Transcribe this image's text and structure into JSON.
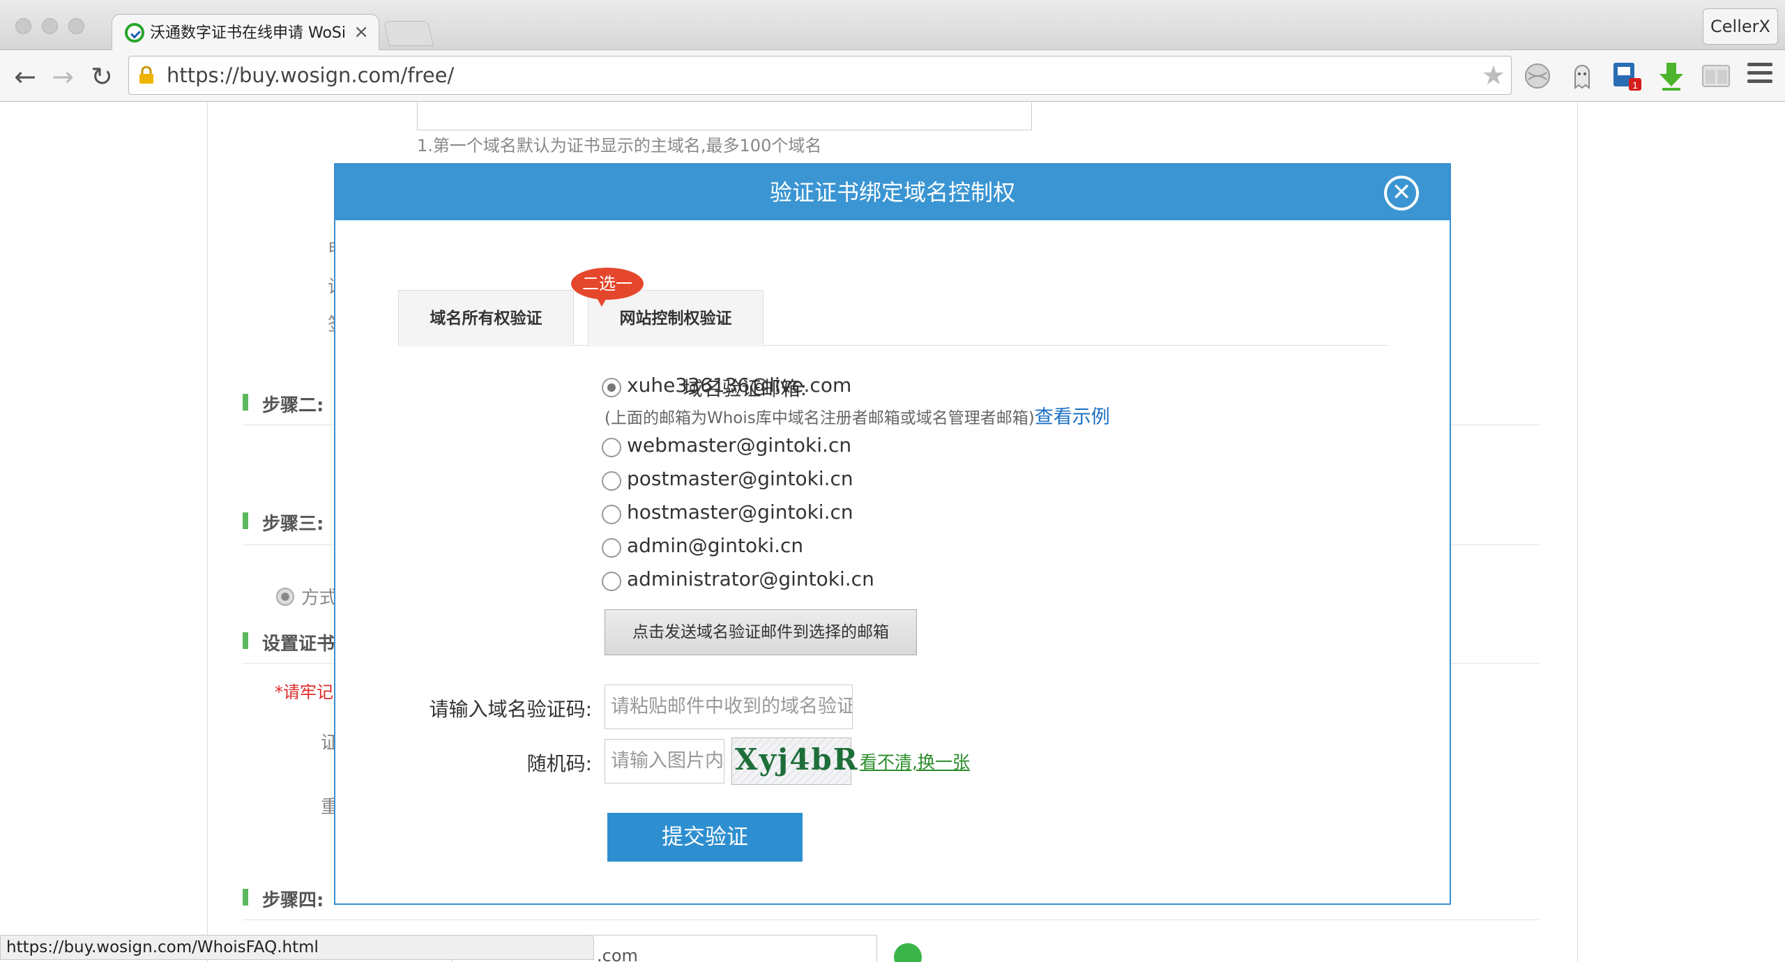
{
  "browser": {
    "tab_title": "沃通数字证书在线申请 WoSign",
    "tab_close": "×",
    "url": "https://buy.wosign.com/free/",
    "profile_name": "CellerX",
    "status_url": "https://buy.wosign.com/WhoisFAQ.html"
  },
  "background": {
    "hint1": "1.第一个域名默认为证书显示的主域名,最多100个域名",
    "step2": "步骤二:",
    "step3": "步骤三:",
    "method": "方式",
    "set_cert": "设置证书",
    "warning": "*请牢记",
    "step4": "步骤四:",
    "frag_a": "申",
    "frag_b": "设",
    "frag_c": "签",
    "frag_d": "证",
    "frag_e": "重",
    "domain_frag": ".com"
  },
  "modal": {
    "title": "验证证书绑定域名控制权",
    "close_glyph": "✕",
    "tabs": [
      {
        "label": "域名所有权验证"
      },
      {
        "label": "网站控制权验证"
      }
    ],
    "badge": "二选一",
    "email_label": "域名验证邮箱:",
    "options": [
      {
        "email": "xuhe336136@live.com",
        "checked": true
      },
      {
        "email": "webmaster@gintoki.cn",
        "checked": false
      },
      {
        "email": "postmaster@gintoki.cn",
        "checked": false
      },
      {
        "email": "hostmaster@gintoki.cn",
        "checked": false
      },
      {
        "email": "admin@gintoki.cn",
        "checked": false
      },
      {
        "email": "administrator@gintoki.cn",
        "checked": false
      }
    ],
    "whois_note": "(上面的邮箱为Whois库中域名注册者邮箱或域名管理者邮箱)",
    "whois_link": "查看示例",
    "send_button": "点击发送域名验证邮件到选择的邮箱",
    "code_label": "请输入域名验证码:",
    "code_placeholder": "请粘贴邮件中收到的域名验证码",
    "captcha_label": "随机码:",
    "captcha_placeholder": "请输入图片内容",
    "captcha_text": "Xyj4bR",
    "captcha_refresh": "看不清,换一张",
    "submit_button": "提交验证"
  },
  "icons": [
    "back-icon",
    "forward-icon",
    "reload-icon",
    "lock-warning-icon",
    "star-icon",
    "globe-icon",
    "ghost-icon",
    "extension-icon",
    "download-icon",
    "reader-icon",
    "menu-icon"
  ],
  "colors": {
    "header_blue": "#3a95d2",
    "badge_red": "#e5472c",
    "submit_blue": "#2e8fd0",
    "link_green": "#2a8d2a"
  }
}
